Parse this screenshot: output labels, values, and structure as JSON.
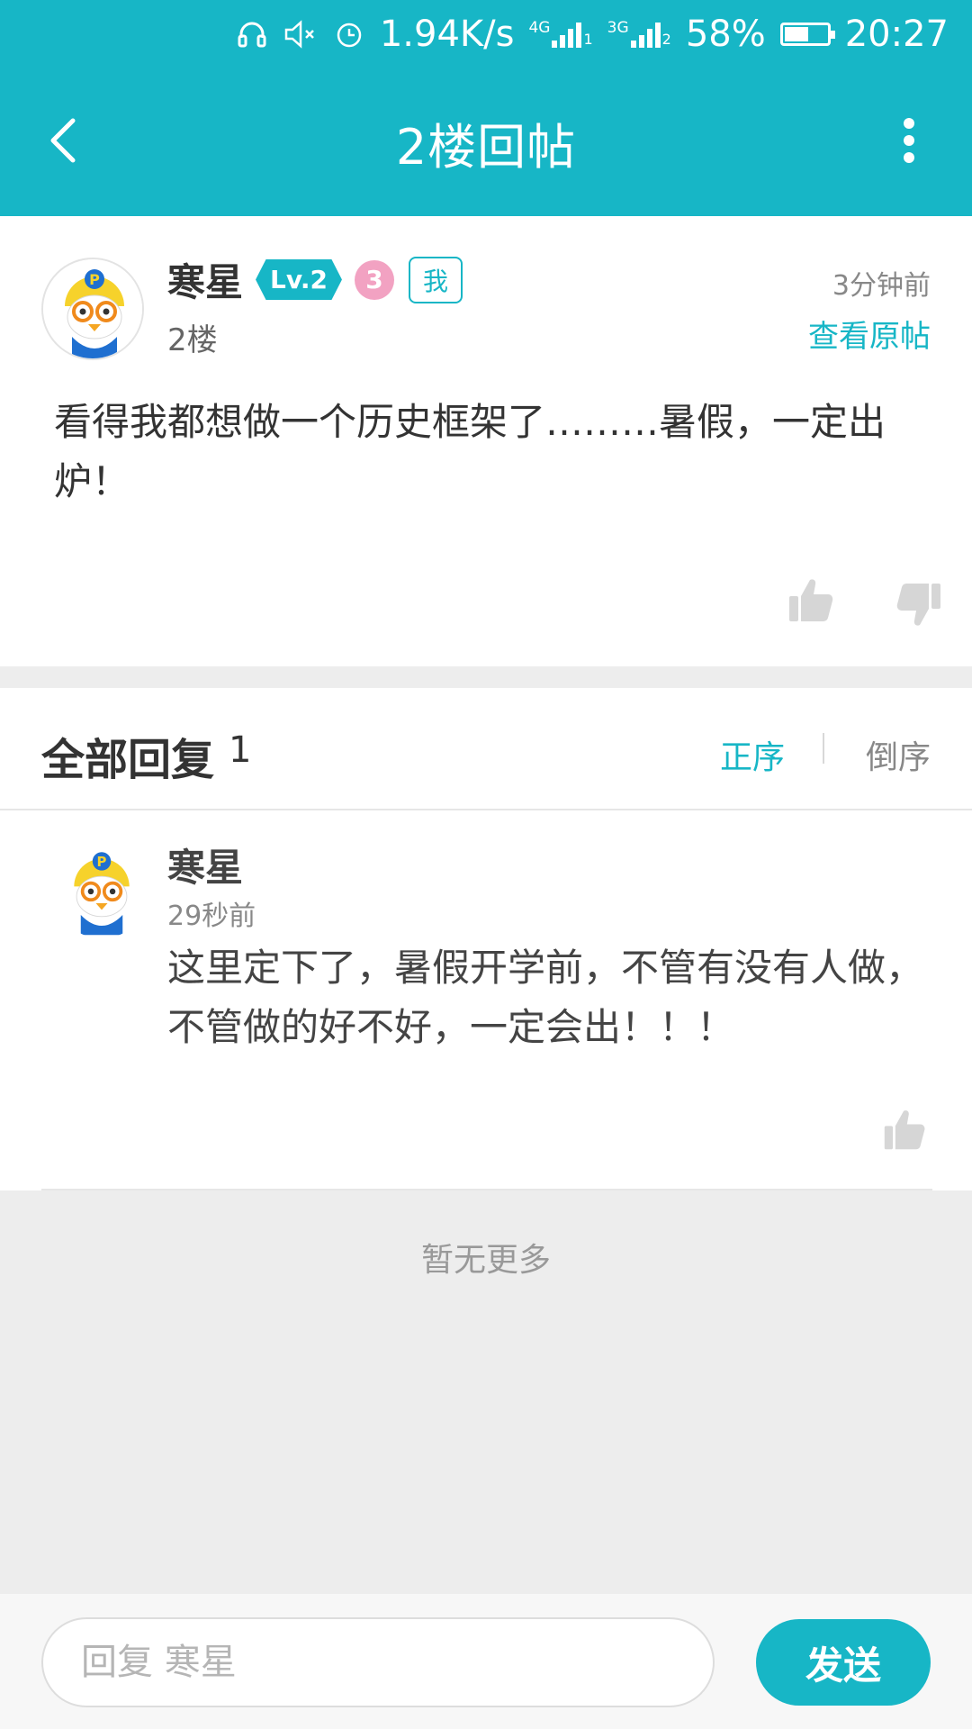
{
  "status_bar": {
    "net_speed": "1.94K/s",
    "sim1_type": "4G",
    "sim1_index": "1",
    "sim2_type": "3G",
    "sim2_index": "2",
    "battery": "58%",
    "battery_level": 0.58,
    "time": "20:27",
    "icons": [
      "headphones-icon",
      "mute-icon",
      "alarm-icon"
    ]
  },
  "header": {
    "title": "2楼回帖",
    "back_icon": "chevron-left-icon",
    "more_icon": "more-vertical-icon",
    "bg_color": "#17b6c6"
  },
  "post": {
    "author": "寒星",
    "level": "Lv.2",
    "medal": "3",
    "me_tag": "我",
    "floor": "2楼",
    "time": "3分钟前",
    "view_original": "查看原帖",
    "content": "看得我都想做一个历史框架了………暑假，一定出炉！"
  },
  "replies": {
    "title": "全部回复",
    "count": "1",
    "sort_asc": "正序",
    "sort_desc": "倒序",
    "items": [
      {
        "author": "寒星",
        "time": "29秒前",
        "content": "这里定下了，暑假开学前，不管有没有人做，不管做的好不好，一定会出！！！"
      }
    ],
    "no_more": "暂无更多"
  },
  "composer": {
    "placeholder": "回复 寒星",
    "send_label": "发送"
  }
}
